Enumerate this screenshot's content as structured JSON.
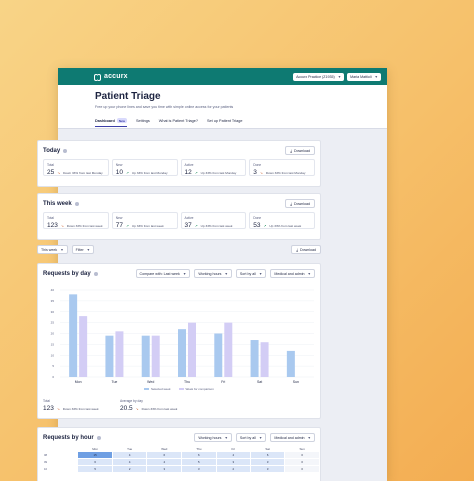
{
  "topbar": {
    "logo_text": "accurx",
    "practice_select": "Accurx Practice (Z1935)",
    "user_select": "Maria Mattioli"
  },
  "header": {
    "title": "Patient Triage",
    "subtitle": "Free up your phone lines and save you time with simple online access for your patients",
    "tabs": [
      {
        "label": "Dashboard",
        "badge": "New",
        "active": true
      },
      {
        "label": "Settings"
      },
      {
        "label": "What is Patient Triage?"
      },
      {
        "label": "Set up Patient Triage"
      }
    ]
  },
  "today": {
    "title": "Today",
    "download_label": "Download",
    "stats": [
      {
        "label": "Total",
        "value": "25",
        "direction": "down",
        "change": "Down 33% from last Monday"
      },
      {
        "label": "New",
        "value": "10",
        "direction": "up",
        "change": "Up 33% from last Monday"
      },
      {
        "label": "Active",
        "value": "12",
        "direction": "up",
        "change": "Up 33% from last Monday"
      },
      {
        "label": "Done",
        "value": "3",
        "direction": "down",
        "change": "Down 33% from last Monday"
      }
    ]
  },
  "this_week": {
    "title": "This week",
    "download_label": "Download",
    "stats": [
      {
        "label": "Total",
        "value": "123",
        "direction": "down",
        "change": "Down 33% from last week"
      },
      {
        "label": "New",
        "value": "77",
        "direction": "up",
        "change": "Up 33% from last week"
      },
      {
        "label": "Active",
        "value": "37",
        "direction": "up",
        "change": "Up 33% from last week"
      },
      {
        "label": "Done",
        "value": "53",
        "direction": "up",
        "change": "Up 33% from last week"
      }
    ]
  },
  "filters": {
    "week_label": "This week",
    "filter_label": "Filter",
    "download_label": "Download"
  },
  "requests_by_day": {
    "title": "Requests by day",
    "controls": [
      "Compare with: Last week",
      "Working hours",
      "Sort by all",
      "Medical and admin"
    ],
    "summary": [
      {
        "label": "Total",
        "value": "123",
        "direction": "down",
        "change": "Down 33% from last week"
      },
      {
        "label": "Average by day",
        "value": "20.5",
        "direction": "down",
        "change": "Down 33% from last week"
      }
    ]
  },
  "chart_data": {
    "type": "bar",
    "categories": [
      "Mon",
      "Tue",
      "Wed",
      "Thu",
      "Fri",
      "Sat",
      "Sun"
    ],
    "series": [
      {
        "name": "Selected week",
        "values": [
          38,
          19,
          19,
          22,
          20,
          17,
          12
        ],
        "color": "#a9c9ef"
      },
      {
        "name": "Week for comparison",
        "values": [
          28,
          21,
          19,
          25,
          25,
          16,
          0
        ],
        "color": "#d3cdf5"
      }
    ],
    "y_ticks": [
      "40",
      "35",
      "30",
      "25",
      "20",
      "15",
      "10",
      "5",
      "0"
    ],
    "ylim": [
      0,
      40
    ],
    "grid": true,
    "legend": "bottom-center"
  },
  "requests_by_hour": {
    "title": "Requests by hour",
    "controls": [
      "Working hours",
      "Sort by all",
      "Medical and admin"
    ],
    "days": [
      "Mon",
      "Tue",
      "Wed",
      "Thu",
      "Fri",
      "Sat",
      "Sun"
    ],
    "rows": [
      {
        "hour": "08",
        "cells": [
          "15",
          "4",
          "6",
          "6",
          "4",
          "6",
          "0"
        ]
      },
      {
        "hour": "09",
        "cells": [
          "6",
          "4",
          "4",
          "5",
          "3",
          "3",
          "0"
        ]
      },
      {
        "hour": "10",
        "cells": [
          "5",
          "2",
          "3",
          "3",
          "2",
          "3",
          "0"
        ]
      }
    ]
  },
  "colors": {
    "brand": "#0e7a72",
    "accent": "#3b3ea8",
    "heat_strong": "#6f9fe3",
    "heat_light": "#dbe6f8"
  }
}
